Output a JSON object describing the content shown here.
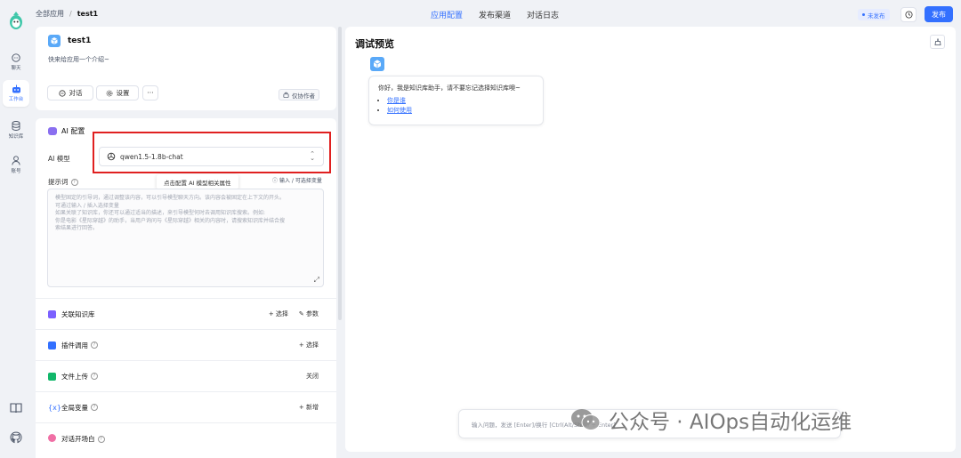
{
  "breadcrumb": {
    "root": "全部应用",
    "separator": "/",
    "current": "test1"
  },
  "top_tabs": [
    {
      "label": "应用配置",
      "active": true
    },
    {
      "label": "发布渠道",
      "active": false
    },
    {
      "label": "对话日志",
      "active": false
    }
  ],
  "header": {
    "status": "未发布",
    "publish_label": "发布"
  },
  "sidebar": {
    "items": [
      {
        "label": "聊天",
        "icon": "chat-icon",
        "active": false
      },
      {
        "label": "工作台",
        "icon": "robot-icon",
        "active": true
      },
      {
        "label": "知识库",
        "icon": "database-icon",
        "active": false
      },
      {
        "label": "账号",
        "icon": "user-icon",
        "active": false
      }
    ],
    "bottom_icons": [
      "book-icon",
      "github-icon"
    ]
  },
  "app": {
    "name": "test1",
    "intro": "快来给应用一个介绍~",
    "chat_button": "对话",
    "settings_button": "设置",
    "more_button": "···",
    "author_badge": "仅协作者"
  },
  "config": {
    "section_title": "AI 配置",
    "model_label": "AI 模型",
    "model_value": "qwen1.5-1.8b-chat",
    "tooltip": "点击配置 AI 模型相关属性",
    "prompt_label": "提示词",
    "var_hint": "输入 / 可选择变量",
    "prompt_placeholder_lines": [
      "模型固定的引导词，通过调整该内容，可以引导模型聊天方向。该内容会被固定在上下文的开头。",
      "可通过输入 / 插入选择变量",
      "如果关联了知识库，你还可以通过适当的描述，来引导模型何时去调用知识库搜索。例如:",
      "你是电影《星际穿越》的助手，当用户询问与《星际穿越》相关的内容时，请搜索知识库并结合搜",
      "索结果进行回答。"
    ],
    "rows": [
      {
        "title": "关联知识库",
        "icon_color": "#7b61ff",
        "help": false,
        "actions": [
          "+ 选择",
          "参数"
        ]
      },
      {
        "title": "插件调用",
        "icon_color": "#3370ff",
        "help": true,
        "actions": [
          "+ 选择"
        ]
      },
      {
        "title": "文件上传",
        "icon_color": "#12b76a",
        "help": true,
        "actions": [
          "关闭"
        ]
      },
      {
        "title": "全局变量",
        "icon_color": "#3370ff",
        "help": true,
        "actions": [
          "+ 新增"
        ]
      },
      {
        "title": "对话开场白",
        "icon_color": "#f06fa5",
        "help": true,
        "actions": []
      }
    ]
  },
  "preview": {
    "title": "调试预览",
    "welcome": "你好，我是知识库助手，请不要忘记选择知识库噢~",
    "links": [
      "你是谁",
      "如何使用"
    ],
    "input_placeholder": "输入问题，发送 [Enter]/换行 [Ctrl(Alt/Shift) + Enter]"
  },
  "watermark": {
    "text": "公众号 · AIOps自动化运维"
  },
  "colors": {
    "accent": "#3370ff",
    "highlight": "#e02020",
    "background": "#f0f2f6"
  }
}
